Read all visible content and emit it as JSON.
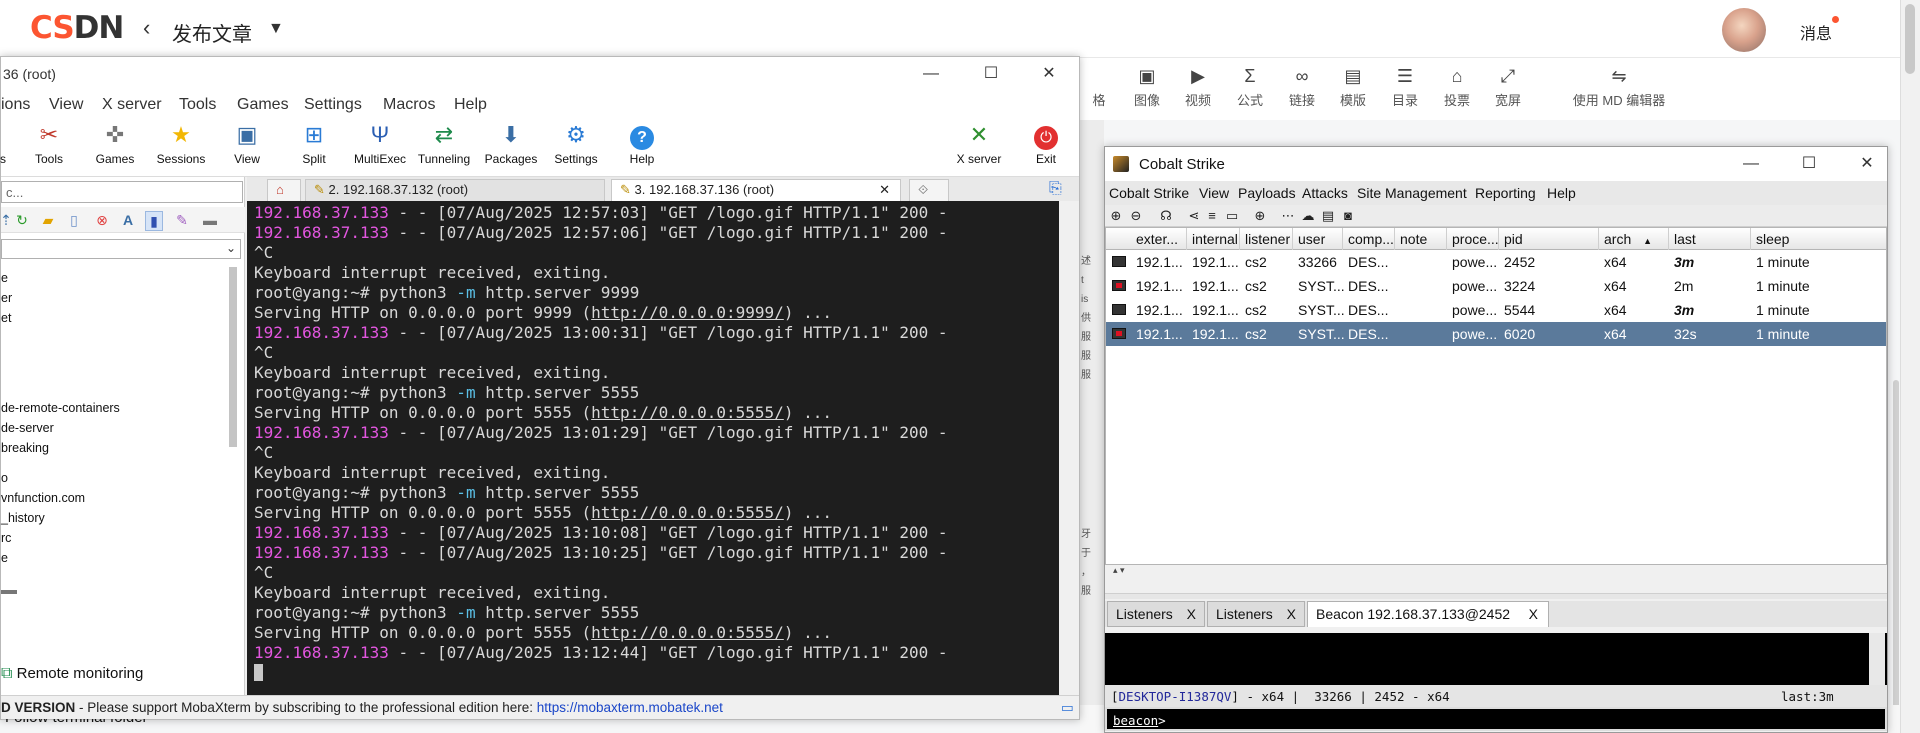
{
  "csdn": {
    "logo": "CSDN",
    "back_icon": "chevron-left-icon",
    "title": "发布文章",
    "caret_icon": "caret-down-icon",
    "messages": "消息",
    "toolbar": [
      {
        "icon": "heading-icon",
        "label": "格"
      },
      {
        "icon": "image-icon",
        "label": "图像"
      },
      {
        "icon": "video-icon",
        "label": "视频"
      },
      {
        "icon": "sigma-icon",
        "label": "公式"
      },
      {
        "icon": "link-icon",
        "label": "链接"
      },
      {
        "icon": "template-icon",
        "label": "模版"
      },
      {
        "icon": "toc-icon",
        "label": "目录"
      },
      {
        "icon": "vote-icon",
        "label": "投票"
      },
      {
        "icon": "widescreen-icon",
        "label": "宽屏"
      },
      {
        "icon": "switch-editor-icon",
        "label": "使用 MD 编辑器"
      }
    ],
    "gutter": [
      "述",
      "t",
      "is",
      "供",
      "服",
      "服",
      "服"
    ],
    "gutter2": [
      "牙",
      "于",
      "，",
      "服"
    ]
  },
  "moba": {
    "title": "36 (root)",
    "menu": [
      "ions",
      "View",
      "X server",
      "Tools",
      "Games",
      "Settings",
      "Macros",
      "Help"
    ],
    "toolbar": [
      {
        "label": "s",
        "icon": "partial-icon"
      },
      {
        "label": "Tools",
        "icon": "tools-icon"
      },
      {
        "label": "Games",
        "icon": "gamepad-icon"
      },
      {
        "label": "Sessions",
        "icon": "star-icon"
      },
      {
        "label": "View",
        "icon": "monitor-icon"
      },
      {
        "label": "Split",
        "icon": "split-icon"
      },
      {
        "label": "MultiExec",
        "icon": "fork-icon"
      },
      {
        "label": "Tunneling",
        "icon": "tunnel-icon"
      },
      {
        "label": "Packages",
        "icon": "package-icon"
      },
      {
        "label": "Settings",
        "icon": "gears-icon"
      },
      {
        "label": "Help",
        "icon": "help-icon"
      },
      {
        "label": "X server",
        "icon": "x-icon"
      },
      {
        "label": "Exit",
        "icon": "power-icon"
      }
    ],
    "search_placeholder": "c...",
    "files": [
      "e",
      "er",
      "et",
      "de-remote-containers",
      "de-server",
      "breaking",
      "o",
      "vnfunction.com",
      "_history",
      "rc",
      "e"
    ],
    "remote_monitoring": "Remote monitoring",
    "follow_terminal": "Follow terminal folder",
    "tabs": [
      "2. 192.168.37.132 (root)",
      "3. 192.168.37.136 (root)"
    ],
    "tab_close": "✕",
    "terminal": [
      {
        "ip": "192.168.37.133",
        "rest": " - - [07/Aug/2025 12:57:03] \"GET /logo.gif HTTP/1.1\" 200 -"
      },
      {
        "ip": "192.168.37.133",
        "rest": " - - [07/Aug/2025 12:57:06] \"GET /logo.gif HTTP/1.1\" 200 -"
      },
      {
        "text": "^C"
      },
      {
        "text": "Keyboard interrupt received, exiting."
      },
      {
        "prompt": "root@yang:~# ",
        "cmd": "python3",
        "flag": " -m",
        "arg": " http.server 9999"
      },
      {
        "serve": "Serving HTTP on 0.0.0.0 port 9999 (",
        "link": "http://0.0.0.0:9999/",
        "end": ") ..."
      },
      {
        "ip": "192.168.37.133",
        "rest": " - - [07/Aug/2025 13:00:31] \"GET /logo.gif HTTP/1.1\" 200 -"
      },
      {
        "text": "^C"
      },
      {
        "text": "Keyboard interrupt received, exiting."
      },
      {
        "prompt": "root@yang:~# ",
        "cmd": "python3",
        "flag": " -m",
        "arg": " http.server 5555"
      },
      {
        "serve": "Serving HTTP on 0.0.0.0 port 5555 (",
        "link": "http://0.0.0.0:5555/",
        "end": ") ..."
      },
      {
        "ip": "192.168.37.133",
        "rest": " - - [07/Aug/2025 13:01:29] \"GET /logo.gif HTTP/1.1\" 200 -"
      },
      {
        "text": "^C"
      },
      {
        "text": "Keyboard interrupt received, exiting."
      },
      {
        "prompt": "root@yang:~# ",
        "cmd": "python3",
        "flag": " -m",
        "arg": " http.server 5555"
      },
      {
        "serve": "Serving HTTP on 0.0.0.0 port 5555 (",
        "link": "http://0.0.0.0:5555/",
        "end": ") ..."
      },
      {
        "ip": "192.168.37.133",
        "rest": " - - [07/Aug/2025 13:10:08] \"GET /logo.gif HTTP/1.1\" 200 -"
      },
      {
        "ip": "192.168.37.133",
        "rest": " - - [07/Aug/2025 13:10:25] \"GET /logo.gif HTTP/1.1\" 200 -"
      },
      {
        "text": "^C"
      },
      {
        "text": "Keyboard interrupt received, exiting."
      },
      {
        "prompt": "root@yang:~# ",
        "cmd": "python3",
        "flag": " -m",
        "arg": " http.server 5555"
      },
      {
        "serve": "Serving HTTP on 0.0.0.0 port 5555 (",
        "link": "http://0.0.0.0:5555/",
        "end": ") ..."
      },
      {
        "ip": "192.168.37.133",
        "rest": " - - [07/Aug/2025 13:12:44] \"GET /logo.gif HTTP/1.1\" 200 -"
      },
      {
        "cursor": true
      }
    ],
    "status": {
      "edition": "D VERSION",
      "message": " -  Please support MobaXterm by subscribing to the professional edition here:  ",
      "link": "https://mobaxterm.mobatek.net"
    }
  },
  "cs": {
    "title": "Cobalt Strike",
    "menu": [
      "Cobalt Strike",
      "View",
      "Payloads",
      "Attacks",
      "Site Management",
      "Reporting",
      "Help"
    ],
    "toolbar_icons": [
      "plus-circle-icon",
      "minus-circle-icon",
      "headphones-icon",
      "share-icon",
      "list-icon",
      "laptop-icon",
      "globe-icon",
      "keyboard-dots-icon",
      "cloud-download-icon",
      "keyboard-icon",
      "camera-icon"
    ],
    "columns": [
      "exter...",
      "internal",
      "listener",
      "user",
      "comp...",
      "note",
      "proce...",
      "pid",
      "arch",
      "last",
      "sleep"
    ],
    "sort_indicator": "▲",
    "rows": [
      {
        "external": "192.1...",
        "internal": "192.1...",
        "listener": "cs2",
        "user": "33266",
        "computer": "DES...",
        "note": "",
        "process": "powe...",
        "pid": "2452",
        "arch": "x64",
        "last": "3m",
        "sleep": "1 minute",
        "last_bold": true,
        "admin": false,
        "selected": false
      },
      {
        "external": "192.1...",
        "internal": "192.1...",
        "listener": "cs2",
        "user": "SYST...",
        "computer": "DES...",
        "note": "",
        "process": "powe...",
        "pid": "3224",
        "arch": "x64",
        "last": "2m",
        "sleep": "1 minute",
        "last_bold": false,
        "admin": true,
        "selected": false
      },
      {
        "external": "192.1...",
        "internal": "192.1...",
        "listener": "cs2",
        "user": "SYST...",
        "computer": "DES...",
        "note": "",
        "process": "powe...",
        "pid": "5544",
        "arch": "x64",
        "last": "3m",
        "sleep": "1 minute",
        "last_bold": true,
        "admin": false,
        "selected": false
      },
      {
        "external": "192.1...",
        "internal": "192.1...",
        "listener": "cs2",
        "user": "SYST...",
        "computer": "DES...",
        "note": "",
        "process": "powe...",
        "pid": "6020",
        "arch": "x64",
        "last": "32s",
        "sleep": "1 minute",
        "last_bold": false,
        "admin": true,
        "selected": true
      }
    ],
    "tabs": [
      {
        "label": "Listeners",
        "close": "X",
        "active": false
      },
      {
        "label": "Listeners",
        "close": "X",
        "active": false
      },
      {
        "label": "Beacon 192.168.37.133@2452",
        "close": "X",
        "active": true
      }
    ],
    "status": {
      "host": "DESKTOP-I1387QV",
      "info": "] - x64 |  33266 | 2452 - x64",
      "last": "last:3m"
    },
    "prompt": "beacon"
  }
}
